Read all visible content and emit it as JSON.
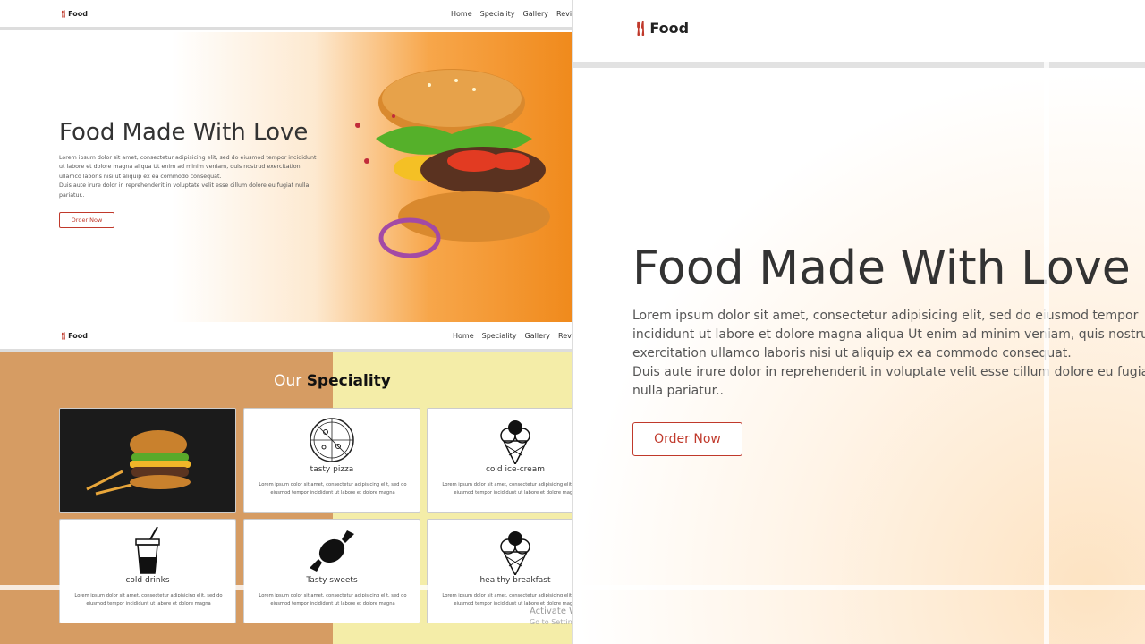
{
  "brand": {
    "logo_text": "Food",
    "logo_icon": "fork-knife-icon",
    "accent": "#c0392b"
  },
  "nav": {
    "links": [
      "Home",
      "Speciality",
      "Gallery",
      "Review"
    ]
  },
  "hero": {
    "title": "Food Made With Love",
    "paragraph1": "Lorem ipsum dolor sit amet, consectetur adipisicing elit, sed do eiusmod tempor incididunt ut labore et dolore magna aliqua Ut enim ad minim veniam, quis nostrud exercitation ullamco laboris nisi ut aliquip ex ea commodo consequat.",
    "paragraph2": "Duis aute irure dolor in reprehenderit in voluptate velit esse cillum dolore eu fugiat nulla pariatur..",
    "button": "Order Now"
  },
  "speciality": {
    "title_part1": "Our",
    "title_part2": "Speciality",
    "cards": [
      {
        "name": "",
        "icon": "burger-photo",
        "desc": ""
      },
      {
        "name": "tasty pizza",
        "icon": "pizza-icon",
        "desc": "Lorem ipsum dolor sit amet, consectetur adipisicing elit, sed do eiusmod tempor incididunt ut labore et dolore magna"
      },
      {
        "name": "cold ice-cream",
        "icon": "ice-cream-icon",
        "desc": "Lorem ipsum dolor sit amet, consectetur adipisicing elit, sed do eiusmod tempor incididunt ut labore et dolore magna"
      },
      {
        "name": "cold drinks",
        "icon": "drink-cup-icon",
        "desc": "Lorem ipsum dolor sit amet, consectetur adipisicing elit, sed do eiusmod tempor incididunt ut labore et dolore magna"
      },
      {
        "name": "Tasty sweets",
        "icon": "candy-icon",
        "desc": "Lorem ipsum dolor sit amet, consectetur adipisicing elit, sed do eiusmod tempor incididunt ut labore et dolore magna"
      },
      {
        "name": "healthy breakfast",
        "icon": "ice-cream-icon",
        "desc": "Lorem ipsum dolor sit amet, consectetur adipisicing elit, sed do eiusmod tempor incididunt ut labore et dolore magna"
      }
    ]
  },
  "watermark": {
    "line1": "Activate W",
    "line2": "Go to Settin"
  },
  "colors": {
    "speciality_left": "#d69c63",
    "speciality_right": "#f4eda8",
    "hero_orange": "#f08a1c"
  }
}
